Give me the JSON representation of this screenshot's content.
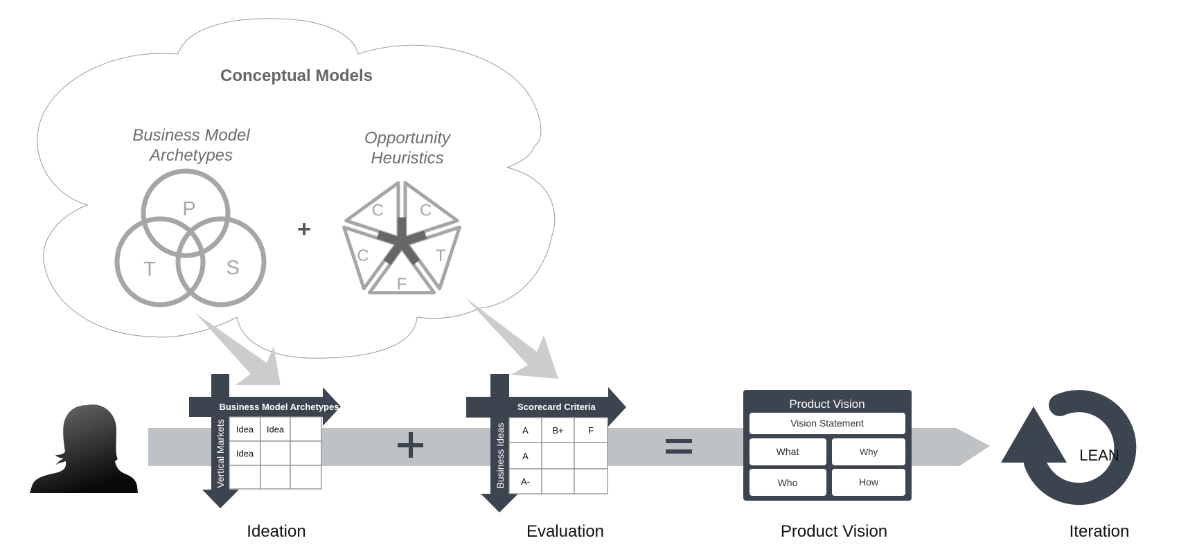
{
  "conceptual_models": {
    "title": "Conceptual Models",
    "operator": "+",
    "business_model_archetypes": {
      "title_line1": "Business Model",
      "title_line2": "Archetypes",
      "circles": [
        "P",
        "T",
        "S"
      ]
    },
    "opportunity_heuristics": {
      "title_line1": "Opportunity",
      "title_line2": "Heuristics",
      "segments": [
        "C",
        "C",
        "T",
        "F",
        "C"
      ]
    }
  },
  "process": {
    "plus_sign": "+",
    "equals_sign": "=",
    "ideation": {
      "label": "Ideation",
      "column_axis": "Business Model Archetypes",
      "row_axis": "Vertical Markets",
      "cells": [
        [
          "Idea",
          "Idea",
          ""
        ],
        [
          "Idea",
          "",
          ""
        ],
        [
          "",
          "",
          ""
        ]
      ]
    },
    "evaluation": {
      "label": "Evaluation",
      "column_axis": "Scorecard Criteria",
      "row_axis": "Business Ideas",
      "cells": [
        [
          "A",
          "B+",
          "F"
        ],
        [
          "A",
          "",
          ""
        ],
        [
          "A-",
          "",
          ""
        ]
      ]
    },
    "product_vision": {
      "label": "Product Vision",
      "card_title": "Product Vision",
      "vision_statement": "Vision Statement",
      "what": "What",
      "why": "Why",
      "who": "Who",
      "how": "How"
    },
    "iteration": {
      "label": "Iteration",
      "cycle_text": "LEAN"
    }
  },
  "colors": {
    "dark": "#3c444f",
    "band": "#bfc2c5",
    "diagram_gray": "#a6a6a6",
    "arrow_gray": "#cccccc"
  }
}
